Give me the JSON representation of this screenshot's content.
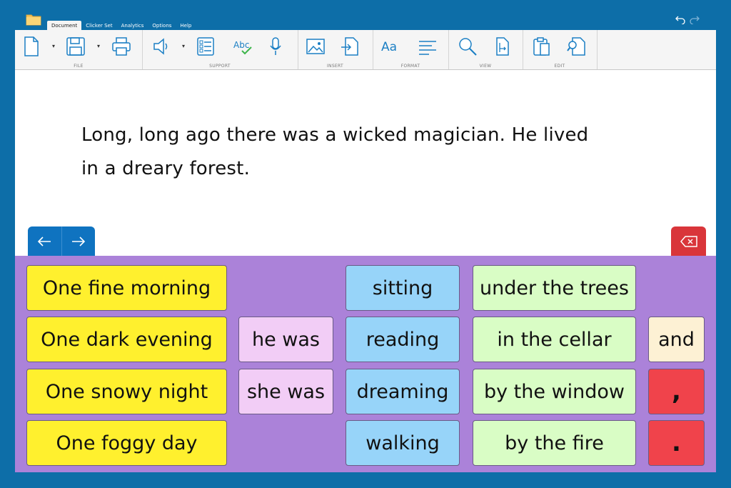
{
  "menu": {
    "tabs": [
      {
        "label": "Document",
        "active": true
      },
      {
        "label": "Clicker Set",
        "active": false
      },
      {
        "label": "Analytics",
        "active": false
      },
      {
        "label": "Options",
        "active": false
      },
      {
        "label": "Help",
        "active": false
      }
    ]
  },
  "ribbon": {
    "groups": {
      "file": "FILE",
      "support": "SUPPORT",
      "insert": "INSERT",
      "format": "FORMAT",
      "view": "VIEW",
      "edit": "EDIT"
    },
    "format_label": "Aa",
    "spell_label": "Abc"
  },
  "document": {
    "line1": "Long, long ago there was a wicked magician. He lived",
    "line2": "in a dreary forest."
  },
  "grid": {
    "col1": [
      "One fine morning",
      "One dark evening",
      "One snowy night",
      "One foggy day"
    ],
    "col2": [
      "he was",
      "she was"
    ],
    "col3": [
      "sitting",
      "reading",
      "dreaming",
      "walking"
    ],
    "col4": [
      "under the trees",
      "in the cellar",
      "by the window",
      "by the fire"
    ],
    "col5": [
      "and",
      ",",
      "."
    ]
  },
  "colors": {
    "background": "#0d6ea8",
    "grid_background": "#ab82d9",
    "yellow": "#fff02e",
    "pink": "#f2cdf6",
    "blue": "#97d4f9",
    "green": "#d9fdc5",
    "cream": "#fdf1d4",
    "red": "#f0434b",
    "nav_blue": "#0f73c0"
  },
  "icons": [
    "folder-icon",
    "undo-icon",
    "redo-icon",
    "new-document-icon",
    "save-icon",
    "print-icon",
    "speaker-icon",
    "list-icon",
    "spellcheck-icon",
    "microphone-icon",
    "image-icon",
    "insert-icon",
    "font-icon",
    "align-icon",
    "search-icon",
    "page-size-icon",
    "paste-icon",
    "find-icon",
    "back-arrow-icon",
    "forward-arrow-icon",
    "backspace-icon"
  ]
}
